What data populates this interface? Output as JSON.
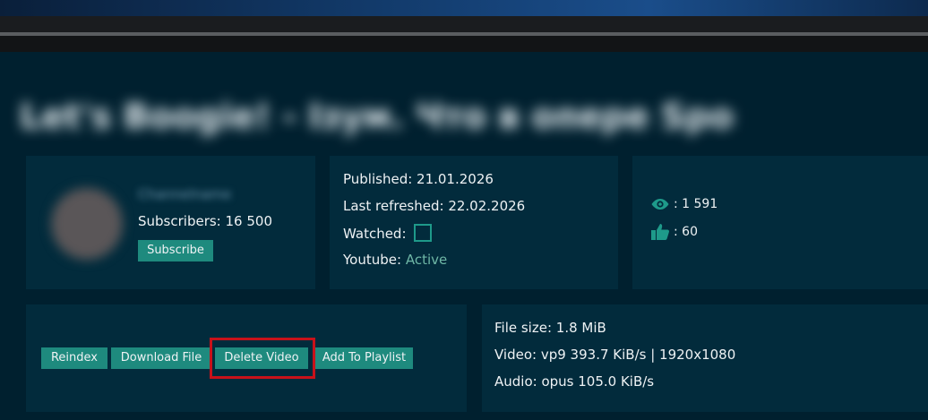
{
  "video": {
    "title": "Let's Boogie! - Ізум. Что в опере Sports"
  },
  "channel": {
    "name": "Channelname",
    "subscribers_label": "Subscribers: 16 500",
    "subscribe_label": "Subscribe"
  },
  "info": {
    "published": "Published: 21.01.2026",
    "last_refreshed": "Last refreshed: 22.02.2026",
    "watched_label": "Watched:",
    "youtube_label": "Youtube:",
    "youtube_status": "Active"
  },
  "stats": {
    "views": ": 1 591",
    "likes": ": 60"
  },
  "actions": {
    "reindex": "Reindex",
    "download": "Download File",
    "delete": "Delete Video",
    "add_playlist": "Add To Playlist"
  },
  "file": {
    "size": "File size: 1.8 MiB",
    "video": "Video: vp9 393.7 KiB/s |  1920x1080",
    "audio": "Audio: opus 105.0 KiB/s"
  },
  "colors": {
    "background": "#00202f",
    "card": "#022b3c",
    "accent": "#1e8a7e",
    "highlight": "#c8121a"
  }
}
